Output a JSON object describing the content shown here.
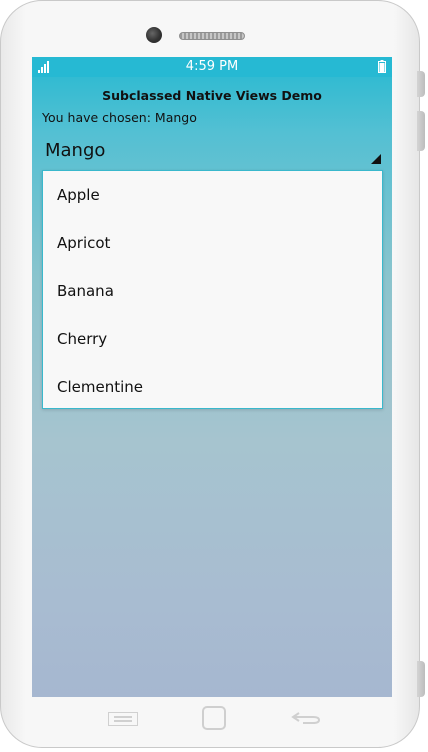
{
  "statusbar": {
    "time": "4:59 PM",
    "icons": [
      "signal-icon",
      "battery-icon"
    ]
  },
  "app": {
    "title": "Subclassed Native Views Demo",
    "chosen_text": "You have chosen: Mango"
  },
  "picker": {
    "selected": "Mango",
    "icon": "dropdown-arrow-icon"
  },
  "dropdown": {
    "items": [
      {
        "label": "Apple"
      },
      {
        "label": "Apricot"
      },
      {
        "label": "Banana"
      },
      {
        "label": "Cherry"
      },
      {
        "label": "Clementine"
      }
    ]
  },
  "navbar": {
    "icons": [
      "menu-icon",
      "home-icon",
      "back-icon"
    ]
  },
  "colors": {
    "statusbar": "#26b9d3",
    "accent": "#39b8cc",
    "dropdown_bg": "#f8f8f8"
  }
}
